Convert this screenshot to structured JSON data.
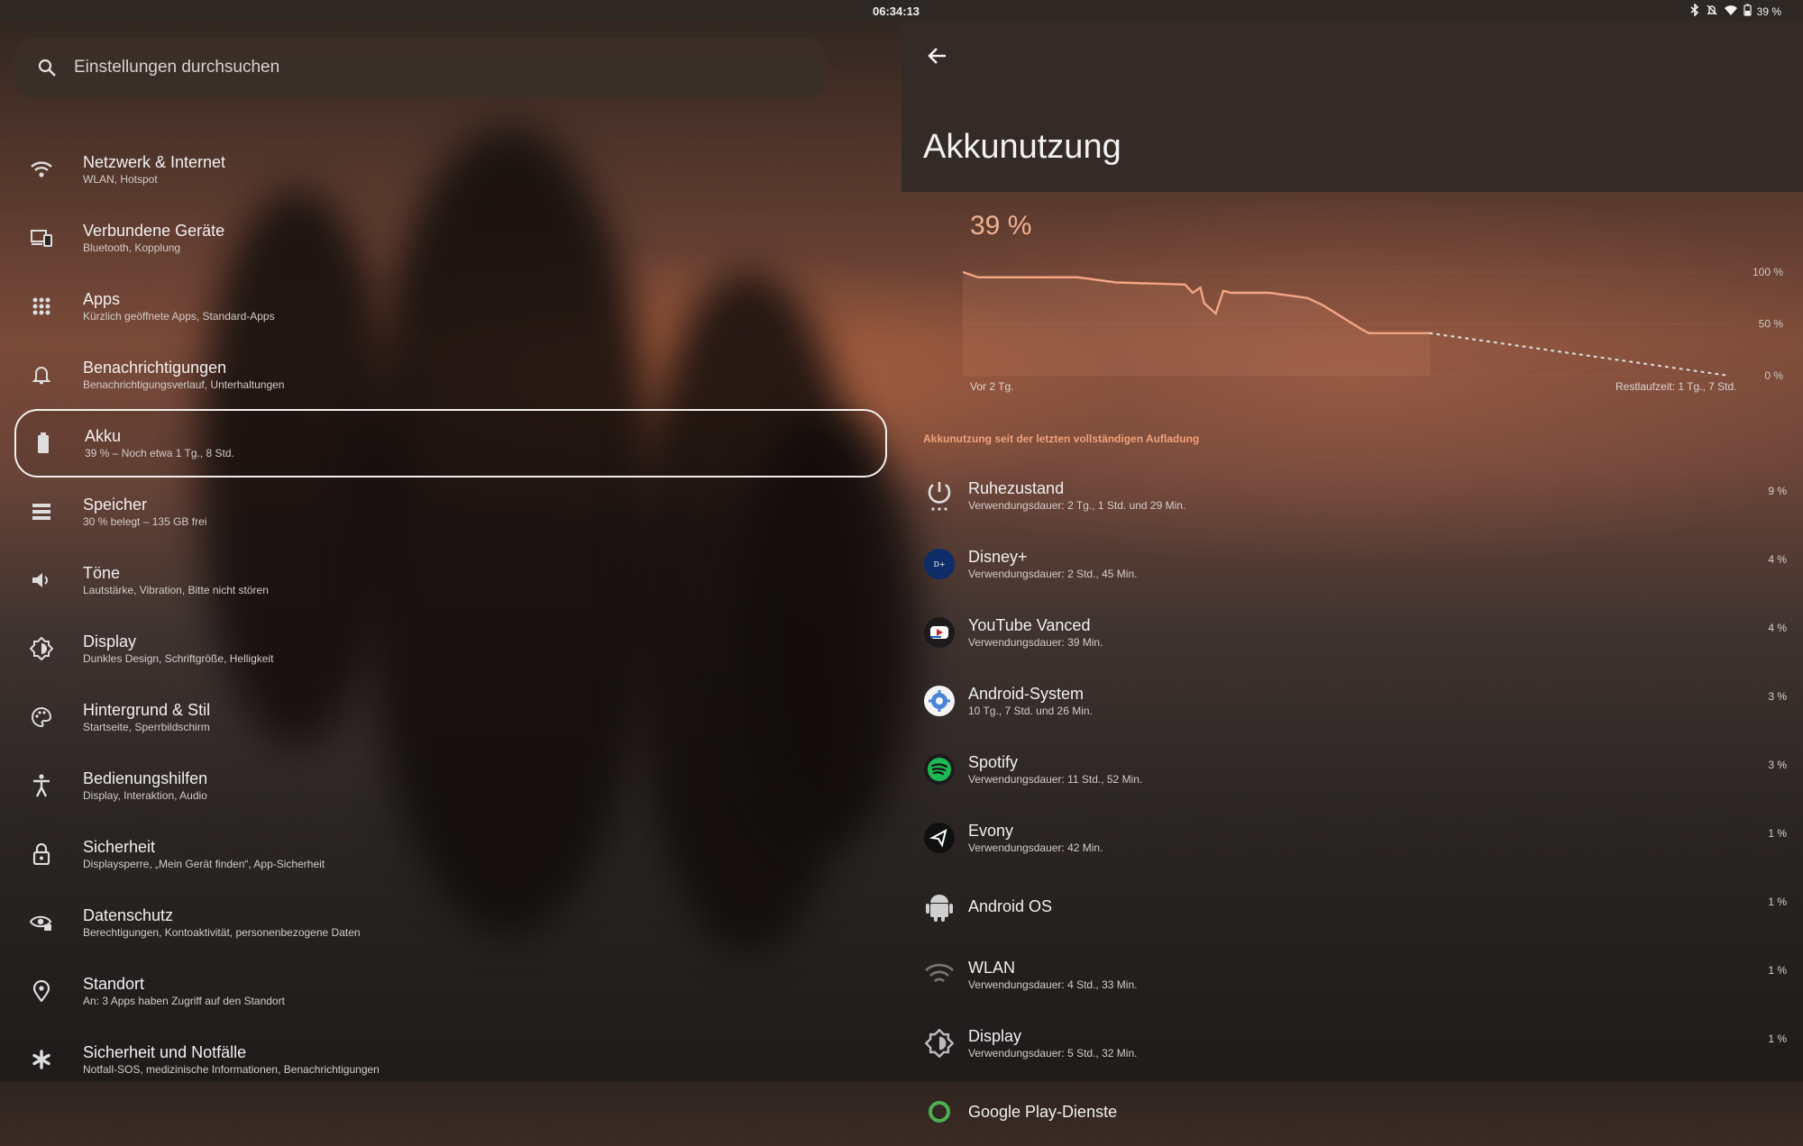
{
  "status_bar": {
    "time": "06:34:13",
    "battery": "39 %",
    "icons": [
      "bluetooth-icon",
      "mute-icon",
      "wifi-icon",
      "battery-icon"
    ]
  },
  "search": {
    "placeholder": "Einstellungen durchsuchen"
  },
  "menu": [
    {
      "title": "Netzwerk & Internet",
      "subtitle": "WLAN, Hotspot",
      "icon": "wifi-icon"
    },
    {
      "title": "Verbundene Geräte",
      "subtitle": "Bluetooth, Kopplung",
      "icon": "devices-icon"
    },
    {
      "title": "Apps",
      "subtitle": "Kürzlich geöffnete Apps, Standard-Apps",
      "icon": "apps-grid-icon"
    },
    {
      "title": "Benachrichtigungen",
      "subtitle": "Benachrichtigungsverlauf, Unterhaltungen",
      "icon": "bell-icon"
    },
    {
      "title": "Akku",
      "subtitle": "39 % – Noch etwa 1 Tg., 8 Std.",
      "icon": "battery-icon",
      "active": true
    },
    {
      "title": "Speicher",
      "subtitle": "30 % belegt – 135 GB frei",
      "icon": "storage-icon"
    },
    {
      "title": "Töne",
      "subtitle": "Lautstärke, Vibration, Bitte nicht stören",
      "icon": "speaker-icon"
    },
    {
      "title": "Display",
      "subtitle": "Dunkles Design, Schriftgröße, Helligkeit",
      "icon": "brightness-icon"
    },
    {
      "title": "Hintergrund & Stil",
      "subtitle": "Startseite, Sperrbildschirm",
      "icon": "palette-icon"
    },
    {
      "title": "Bedienungshilfen",
      "subtitle": "Display, Interaktion, Audio",
      "icon": "accessibility-icon"
    },
    {
      "title": "Sicherheit",
      "subtitle": "Displaysperre, „Mein Gerät finden“, App-Sicherheit",
      "icon": "lock-icon"
    },
    {
      "title": "Datenschutz",
      "subtitle": "Berechtigungen, Kontoaktivität, personenbezogene Daten",
      "icon": "privacy-eye-icon"
    },
    {
      "title": "Standort",
      "subtitle": "An: 3 Apps haben Zugriff auf den Standort",
      "icon": "location-pin-icon"
    },
    {
      "title": "Sicherheit und Notfälle",
      "subtitle": "Notfall-SOS, medizinische Informationen, Benachrichtigungen",
      "icon": "asterisk-icon"
    }
  ],
  "battery_page": {
    "title": "Akkunutzung",
    "level": "39 %",
    "x_start": "Vor 2 Tg.",
    "x_end": "Restlaufzeit: 1 Tg., 7 Std.",
    "y_labels": [
      "100 %",
      "50 %",
      "0 %"
    ],
    "section_label": "Akkunutzung seit der letzten vollständigen Aufladung",
    "apps": [
      {
        "name": "Ruhezustand",
        "detail": "Verwendungsdauer: 2 Tg., 1 Std. und 29 Min.",
        "percent": "9 %",
        "icon": "power-icon"
      },
      {
        "name": "Disney+",
        "detail": "Verwendungsdauer: 2 Std., 45 Min.",
        "percent": "4 %",
        "icon": "disney-plus-icon"
      },
      {
        "name": "YouTube Vanced",
        "detail": "Verwendungsdauer: 39 Min.",
        "percent": "4 %",
        "icon": "youtube-vanced-icon"
      },
      {
        "name": "Android-System",
        "detail": "10 Tg., 7 Std. und 26 Min.",
        "percent": "3 %",
        "icon": "android-system-gear-icon"
      },
      {
        "name": "Spotify",
        "detail": "Verwendungsdauer: 11 Std., 52 Min.",
        "percent": "3 %",
        "icon": "spotify-icon"
      },
      {
        "name": "Evony",
        "detail": "Verwendungsdauer: 42 Min.",
        "percent": "1 %",
        "icon": "evony-icon"
      },
      {
        "name": "Android OS",
        "detail": "",
        "percent": "1 %",
        "icon": "android-robot-icon"
      },
      {
        "name": "WLAN",
        "detail": "Verwendungsdauer: 4 Std., 33 Min.",
        "percent": "1 %",
        "icon": "wifi-icon"
      },
      {
        "name": "Display",
        "detail": "Verwendungsdauer: 5 Std., 32 Min.",
        "percent": "1 %",
        "icon": "brightness-icon"
      },
      {
        "name": "Google Play-Dienste",
        "detail": "",
        "percent": "",
        "icon": "google-play-services-icon"
      }
    ]
  },
  "chart_data": {
    "type": "line",
    "xlabel": "",
    "ylabel": "",
    "ylim": [
      0,
      100
    ],
    "x_labels": [
      "Vor 2 Tg.",
      "Restlaufzeit: 1 Tg., 7 Std."
    ],
    "series": [
      {
        "x": [
          0,
          0.02,
          0.15,
          0.2,
          0.29,
          0.3,
          0.31,
          0.315,
          0.33,
          0.34,
          0.35,
          0.4,
          0.42,
          0.45,
          0.47,
          0.52,
          0.53,
          0.61
        ],
        "values": [
          100,
          95,
          95,
          90,
          88,
          80,
          85,
          70,
          60,
          82,
          80,
          80,
          78,
          75,
          68,
          45,
          41,
          41
        ]
      },
      {
        "x": [
          0.61,
          1.0
        ],
        "values": [
          41,
          0
        ]
      }
    ]
  }
}
